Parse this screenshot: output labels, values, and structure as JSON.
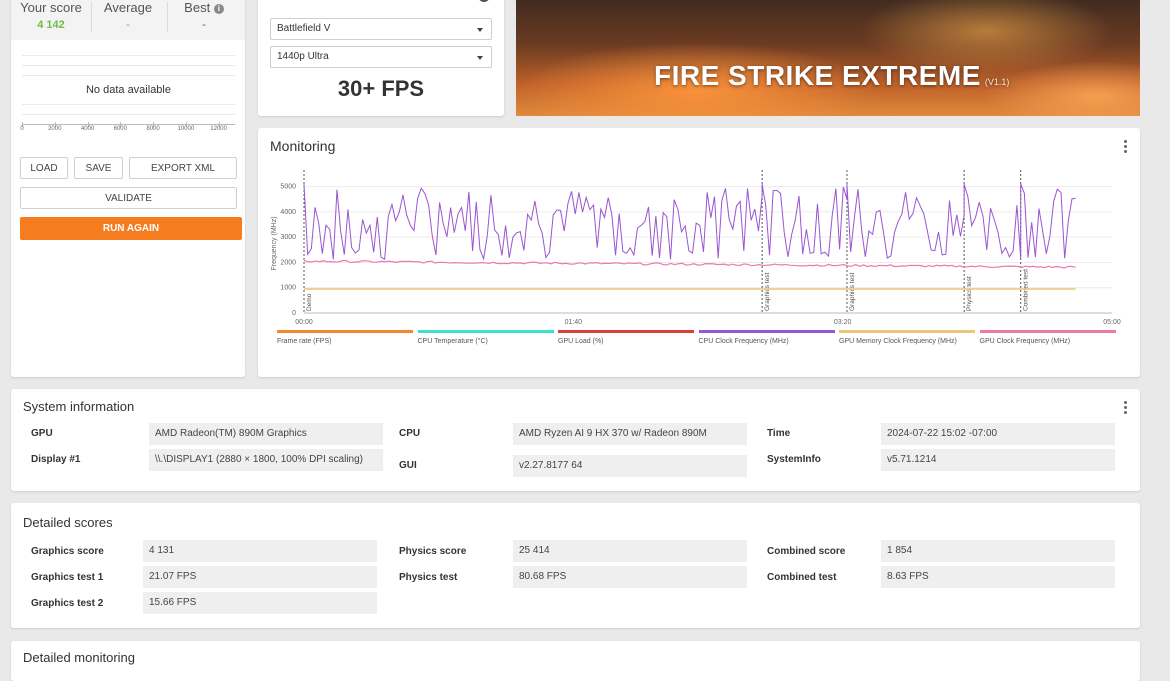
{
  "score_card": {
    "your_score_label": "Your score",
    "your_score_value": "4 142",
    "average_label": "Average",
    "average_value": "-",
    "best_label": "Best",
    "best_value": "-",
    "no_data": "No data available",
    "histogram_ticks": [
      "0",
      "2000",
      "4000",
      "6000",
      "8000",
      "10000",
      "12000"
    ],
    "buttons": {
      "load": "LOAD",
      "save": "SAVE",
      "export": "EXPORT XML",
      "validate": "VALIDATE",
      "run_again": "RUN AGAIN"
    }
  },
  "game_performance": {
    "game": "Battlefield V",
    "preset": "1440p Ultra",
    "fps": "30+ FPS"
  },
  "banner": {
    "title": "FIRE STRIKE EXTREME",
    "version": "(V1.1)"
  },
  "monitoring": {
    "title": "Monitoring",
    "y_axis_label": "Frequency (MHz)",
    "y_ticks": [
      "5000",
      "4000",
      "3000",
      "2000",
      "1000",
      "0"
    ],
    "x_ticks": [
      "00:00",
      "01:40",
      "03:20",
      "05:00"
    ],
    "markers": [
      "Demo",
      "Graphics test",
      "Graphics test",
      "Physics test",
      "Combined test"
    ],
    "legend": [
      {
        "label": "Frame rate (FPS)",
        "color": "#f08a2c"
      },
      {
        "label": "CPU Temperature (°C)",
        "color": "#3de0c8"
      },
      {
        "label": "GPU Load (%)",
        "color": "#d9403a"
      },
      {
        "label": "CPU Clock Frequency (MHz)",
        "color": "#9a55d0"
      },
      {
        "label": "GPU Memory Clock Frequency (MHz)",
        "color": "#ecc47a"
      },
      {
        "label": "GPU Clock Frequency (MHz)",
        "color": "#ec7aa8"
      }
    ]
  },
  "system_info": {
    "title": "System information",
    "gpu_label": "GPU",
    "gpu_value": "AMD Radeon(TM) 890M Graphics",
    "display_label": "Display #1",
    "display_value": "\\\\.\\DISPLAY1 (2880 × 1800, 100% DPI scaling)",
    "cpu_label": "CPU",
    "cpu_value": "AMD Ryzen AI 9 HX 370 w/ Radeon 890M",
    "gui_label": "GUI",
    "gui_value": "v2.27.8177 64",
    "time_label": "Time",
    "time_value": "2024-07-22 15:02 -07:00",
    "sysinfo_label": "SystemInfo",
    "sysinfo_value": "v5.71.1214"
  },
  "detailed_scores": {
    "title": "Detailed scores",
    "graphics_score_label": "Graphics score",
    "graphics_score_value": "4 131",
    "graphics_test1_label": "Graphics test 1",
    "graphics_test1_value": "21.07 FPS",
    "graphics_test2_label": "Graphics test 2",
    "graphics_test2_value": "15.66 FPS",
    "physics_score_label": "Physics score",
    "physics_score_value": "25 414",
    "physics_test_label": "Physics test",
    "physics_test_value": "80.68 FPS",
    "combined_score_label": "Combined score",
    "combined_score_value": "1 854",
    "combined_test_label": "Combined test",
    "combined_test_value": "8.63 FPS"
  },
  "detailed_monitoring": {
    "title": "Detailed monitoring"
  }
}
